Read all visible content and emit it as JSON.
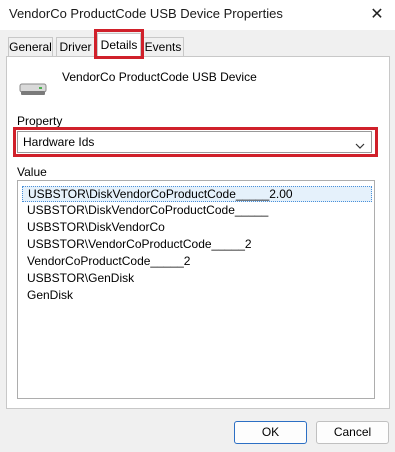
{
  "window": {
    "title": "VendorCo ProductCode USB Device Properties"
  },
  "tabs": [
    {
      "label": "General"
    },
    {
      "label": "Driver"
    },
    {
      "label": "Details"
    },
    {
      "label": "Events"
    }
  ],
  "device": {
    "name": "VendorCo ProductCode USB Device",
    "icon": "usb-drive-icon"
  },
  "property": {
    "label": "Property",
    "selected": "Hardware Ids"
  },
  "value": {
    "label": "Value",
    "items": [
      "USBSTOR\\DiskVendorCoProductCode_____2.00",
      "USBSTOR\\DiskVendorCoProductCode_____",
      "USBSTOR\\DiskVendorCo",
      "USBSTOR\\VendorCoProductCode_____2",
      "VendorCoProductCode_____2",
      "USBSTOR\\GenDisk",
      "GenDisk"
    ]
  },
  "buttons": {
    "ok": "OK",
    "cancel": "Cancel"
  },
  "colors": {
    "highlight": "#d0202a",
    "selection": "#e5f1fb",
    "accent": "#2c6fc4"
  }
}
